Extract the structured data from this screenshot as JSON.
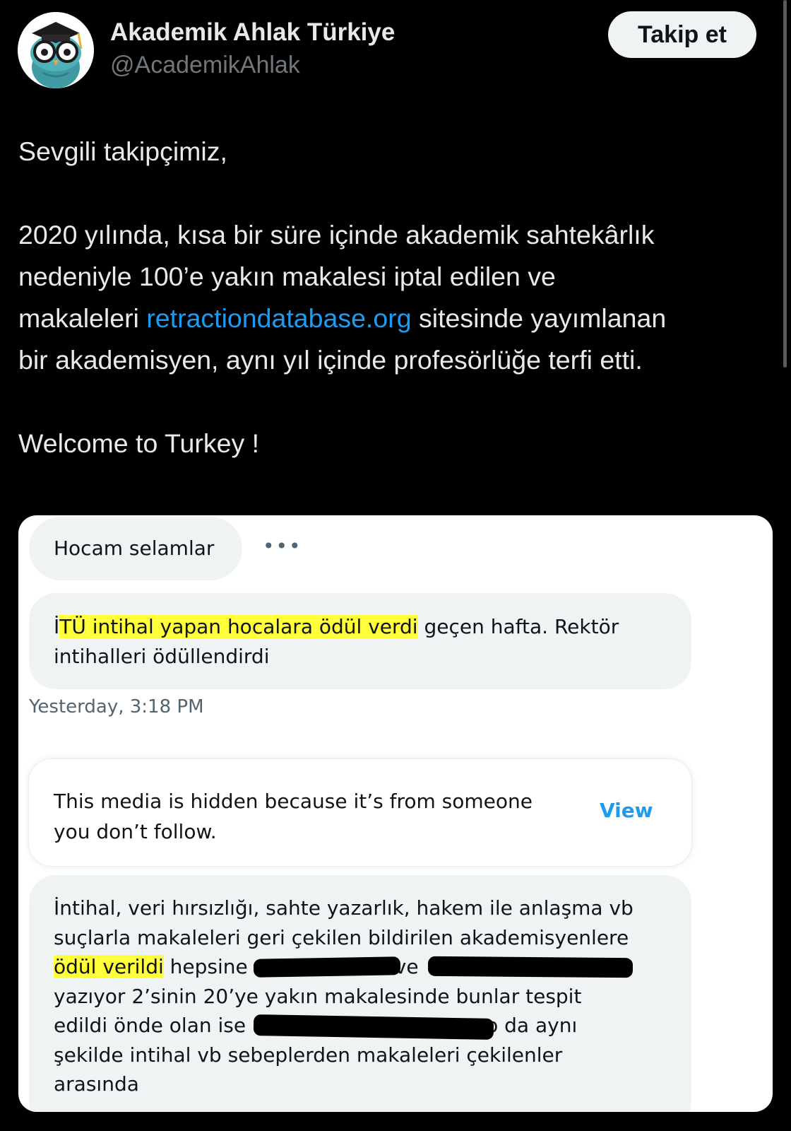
{
  "author": {
    "name": "Akademik Ahlak Türkiye",
    "handle": "@AcademikAhlak",
    "follow_label": "Takip et"
  },
  "tweet": {
    "greeting": "Sevgili takipçimiz,",
    "para_line1": "2020 yılında, kısa bir süre içinde akademik sahtekârlık",
    "para_line2": "nedeniyle 100’e yakın makalesi iptal edilen ve",
    "para_line3_pre": "makaleleri ",
    "link_text": "retractiondatabase.org",
    "para_line3_post": " sitesinde yayımlanan",
    "para_line4": "bir akademisyen, aynı yıl içinde profesörlüğe terfi etti.",
    "closing": "Welcome to Turkey !"
  },
  "screenshot": {
    "msg1": "Hocam selamlar",
    "more": "•••",
    "msg2_pre": "İ",
    "msg2_highlight": "TÜ intihal yapan hocalara ödül verdi",
    "msg2_post": " geçen hafta. Rektör",
    "msg2_line2": "intihalleri ödüllendirdi",
    "timestamp": "Yesterday, 3:18 PM",
    "hidden_line1": "This media is hidden because it’s from someone",
    "hidden_line2": "you don’t follow.",
    "view_label": "View",
    "msg3_line1": "İntihal, veri hırsızlığı, sahte yazarlık, hakem ile anlaşma vb",
    "msg3_line2": "suçlarla makaleleri geri çekilen bildirilen akademisyenlere",
    "msg3_line3_highlight": "ödül verildi",
    "msg3_line3_a": " hepsine",
    "msg3_line3_b": "ve",
    "msg3_line4": "yazıyor 2’sinin 20’ye yakın makalesinde bunlar tespit",
    "msg3_line5_a": "edildi önde olan ise",
    "msg3_line5_b": "o da aynı",
    "msg3_line6": "şekilde intihal vb sebeplerden makaleleri çekilenler",
    "msg3_line7": "arasında"
  },
  "colors": {
    "background": "#000000",
    "link": "#1d9bf0",
    "highlight": "#ffff3b",
    "bubble": "#eff3f4"
  },
  "icons": {
    "avatar": "owl-graduate-icon"
  }
}
